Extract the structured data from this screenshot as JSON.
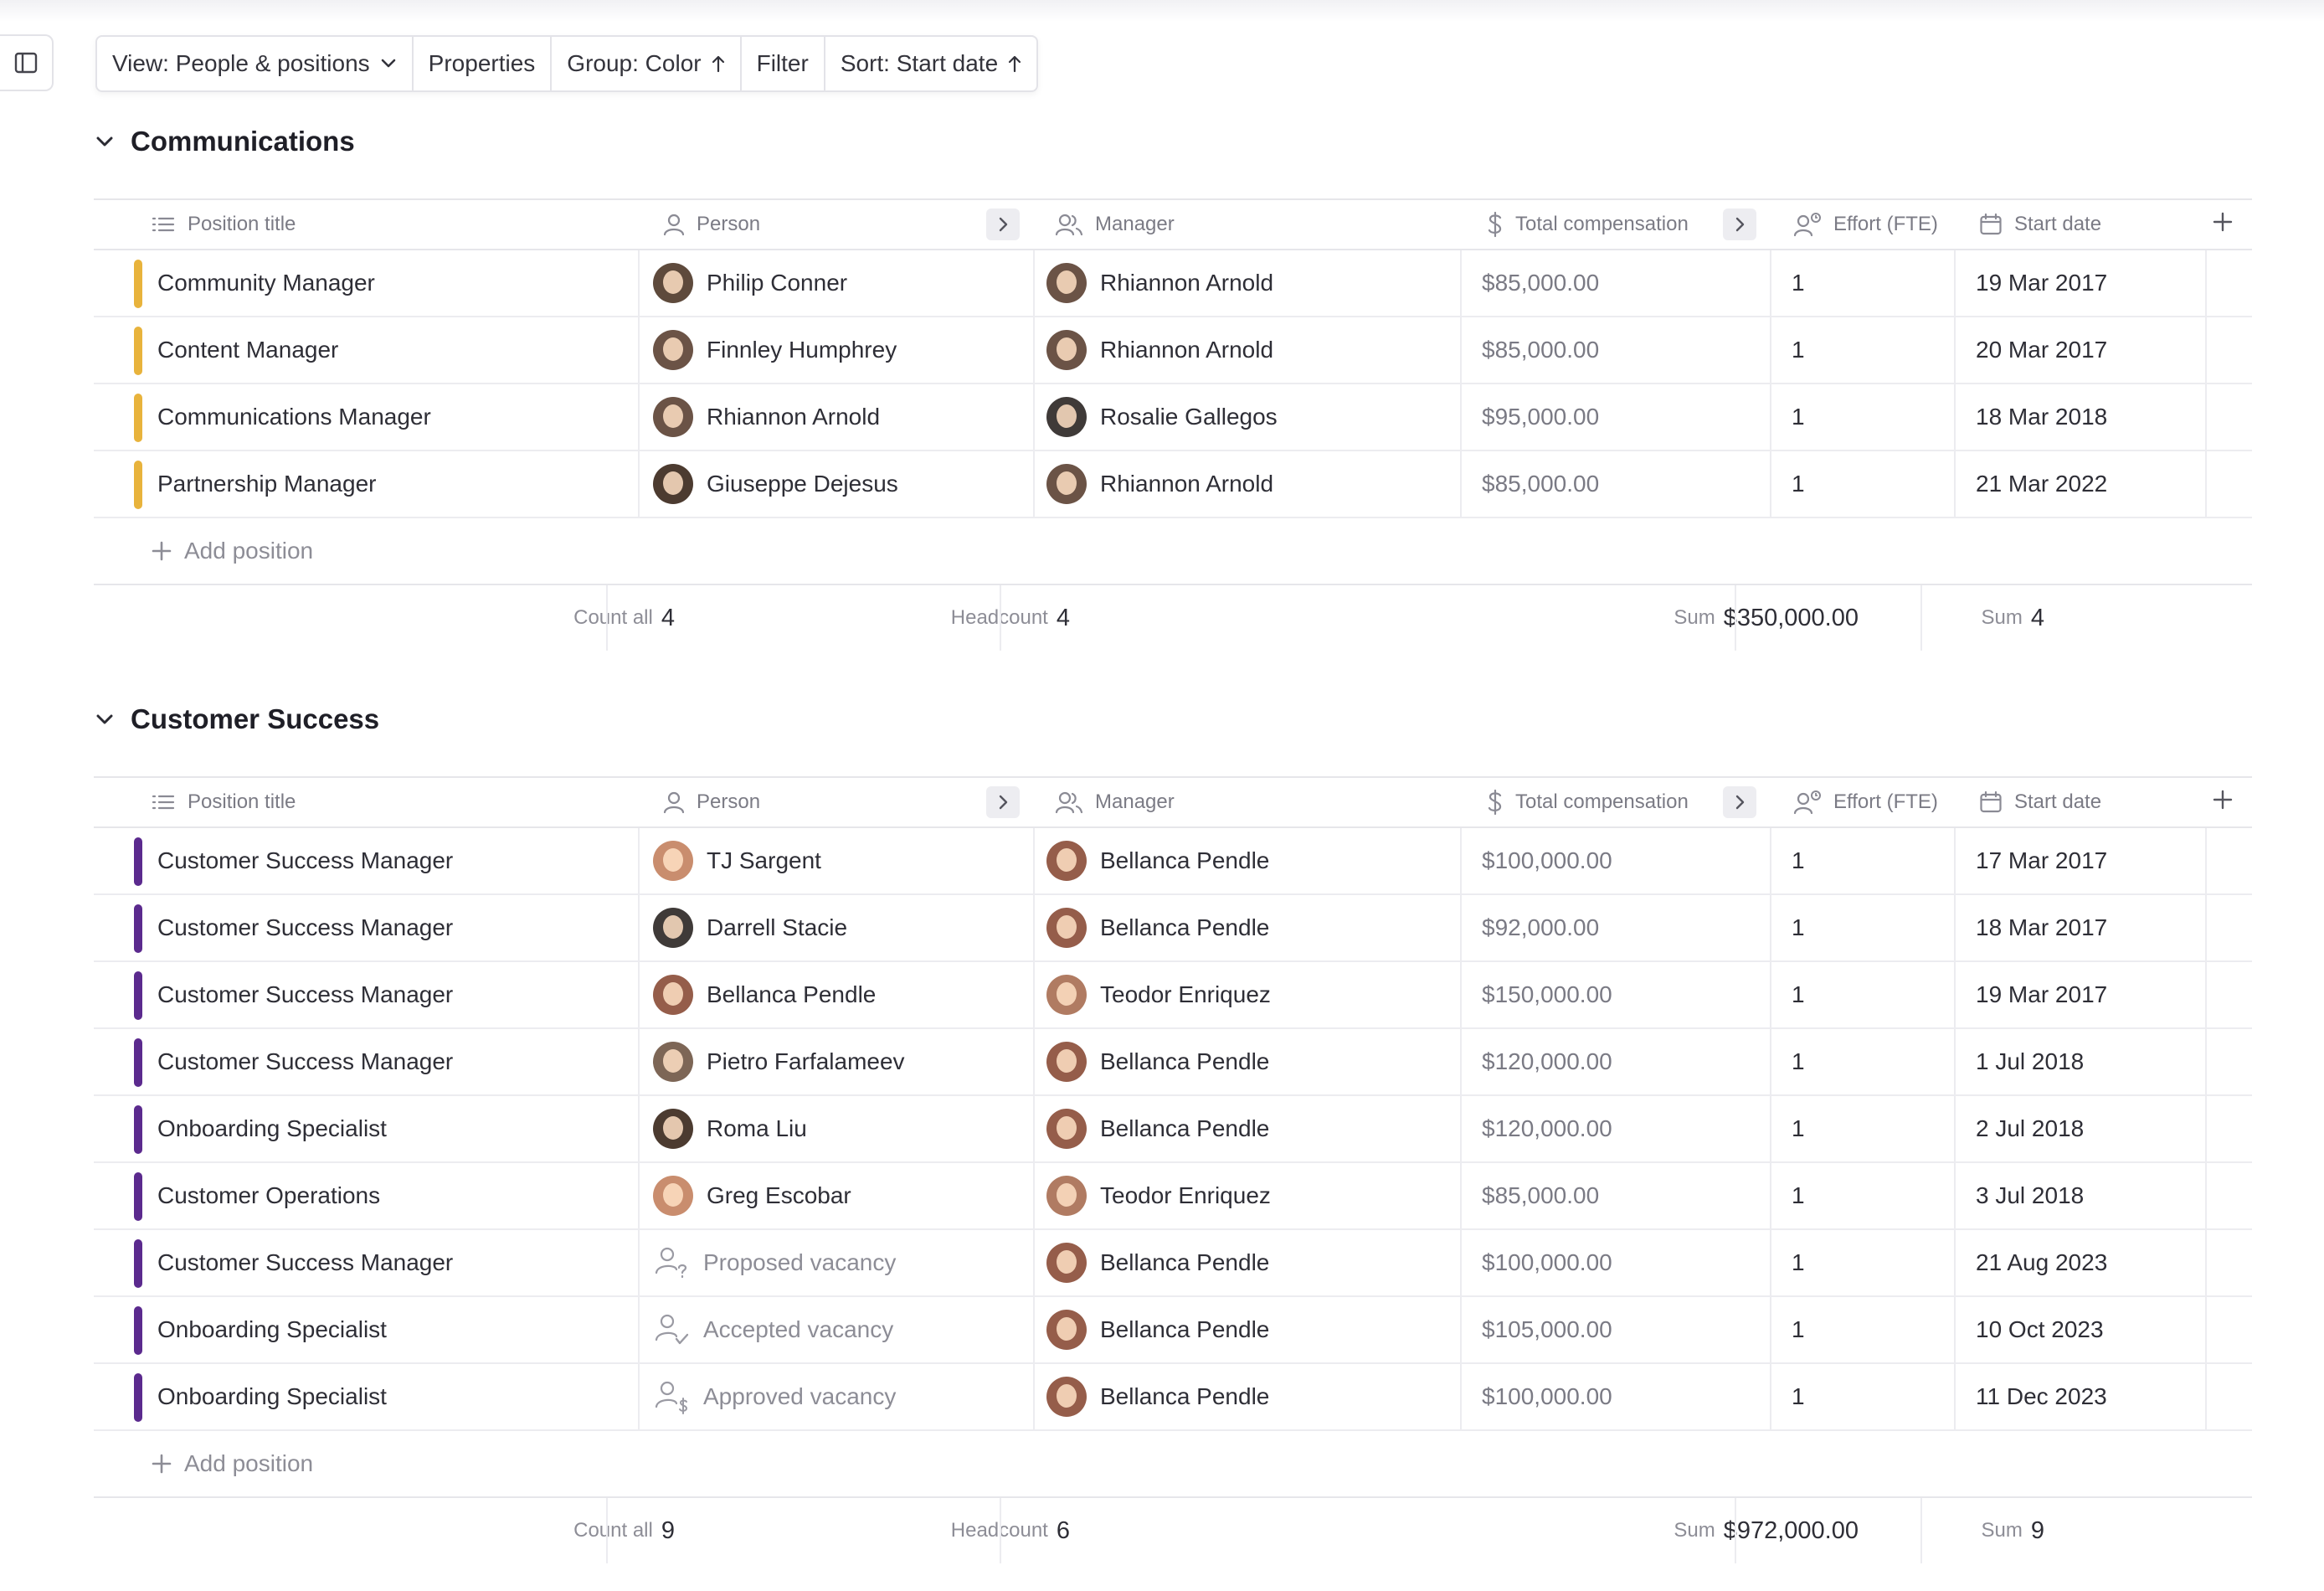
{
  "toolbar": {
    "view_label": "View: People & positions",
    "properties_label": "Properties",
    "group_label": "Group: Color",
    "filter_label": "Filter",
    "sort_label": "Sort: Start date"
  },
  "columns": {
    "position_title": "Position title",
    "person": "Person",
    "manager": "Manager",
    "total_compensation": "Total compensation",
    "effort": "Effort (FTE)",
    "start_date": "Start date"
  },
  "add_position_label": "Add position",
  "colors": {
    "communications": "#e8b33c",
    "customer_success": "#5b2a8e"
  },
  "groups": [
    {
      "name": "Communications",
      "color": "#e8b33c",
      "rows": [
        {
          "title": "Community Manager",
          "person": "Philip Conner",
          "manager": "Rhiannon Arnold",
          "comp": "$85,000.00",
          "effort": "1",
          "start": "19 Mar 2017"
        },
        {
          "title": "Content Manager",
          "person": "Finnley Humphrey",
          "manager": "Rhiannon Arnold",
          "comp": "$85,000.00",
          "effort": "1",
          "start": "20 Mar 2017"
        },
        {
          "title": "Communications Manager",
          "person": "Rhiannon Arnold",
          "manager": "Rosalie Gallegos",
          "comp": "$95,000.00",
          "effort": "1",
          "start": "18 Mar 2018"
        },
        {
          "title": "Partnership Manager",
          "person": "Giuseppe Dejesus",
          "manager": "Rhiannon Arnold",
          "comp": "$85,000.00",
          "effort": "1",
          "start": "21 Mar 2022"
        }
      ],
      "footer": {
        "count_label": "Count all",
        "count_value": "4",
        "headcount_label": "Headcount",
        "headcount_value": "4",
        "comp_label": "Sum",
        "comp_value": "$350,000.00",
        "effort_label": "Sum",
        "effort_value": "4"
      }
    },
    {
      "name": "Customer Success",
      "color": "#5b2a8e",
      "rows": [
        {
          "title": "Customer Success Manager",
          "person": "TJ Sargent",
          "manager": "Bellanca Pendle",
          "comp": "$100,000.00",
          "effort": "1",
          "start": "17 Mar 2017"
        },
        {
          "title": "Customer Success Manager",
          "person": "Darrell Stacie",
          "manager": "Bellanca Pendle",
          "comp": "$92,000.00",
          "effort": "1",
          "start": "18 Mar 2017"
        },
        {
          "title": "Customer Success Manager",
          "person": "Bellanca Pendle",
          "manager": "Teodor Enriquez",
          "comp": "$150,000.00",
          "effort": "1",
          "start": "19 Mar 2017"
        },
        {
          "title": "Customer Success Manager",
          "person": "Pietro Farfalameev",
          "manager": "Bellanca Pendle",
          "comp": "$120,000.00",
          "effort": "1",
          "start": "1 Jul 2018"
        },
        {
          "title": "Onboarding Specialist",
          "person": "Roma Liu",
          "manager": "Bellanca Pendle",
          "comp": "$120,000.00",
          "effort": "1",
          "start": "2 Jul 2018"
        },
        {
          "title": "Customer Operations",
          "person": "Greg Escobar",
          "manager": "Teodor Enriquez",
          "comp": "$85,000.00",
          "effort": "1",
          "start": "3 Jul 2018"
        },
        {
          "title": "Customer Success Manager",
          "person": "Proposed vacancy",
          "vacancy": "proposed",
          "manager": "Bellanca Pendle",
          "comp": "$100,000.00",
          "effort": "1",
          "start": "21 Aug 2023"
        },
        {
          "title": "Onboarding Specialist",
          "person": "Accepted vacancy",
          "vacancy": "accepted",
          "manager": "Bellanca Pendle",
          "comp": "$105,000.00",
          "effort": "1",
          "start": "10 Oct 2023"
        },
        {
          "title": "Onboarding Specialist",
          "person": "Approved vacancy",
          "vacancy": "approved",
          "manager": "Bellanca Pendle",
          "comp": "$100,000.00",
          "effort": "1",
          "start": "11 Dec 2023"
        }
      ],
      "footer": {
        "count_label": "Count all",
        "count_value": "9",
        "headcount_label": "Headcount",
        "headcount_value": "6",
        "comp_label": "Sum",
        "comp_value": "$972,000.00",
        "effort_label": "Sum",
        "effort_value": "9"
      }
    }
  ]
}
